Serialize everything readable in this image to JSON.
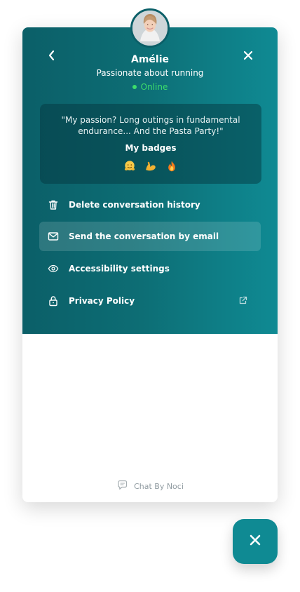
{
  "profile": {
    "name": "Amélie",
    "tagline": "Passionate about running",
    "status": "Online"
  },
  "quote_card": {
    "quote": "\"My passion? Long outings in fundamental endurance... And the Pasta Party!\"",
    "badges_title": "My badges",
    "badges": [
      "hugging-face-icon",
      "flexed-biceps-icon",
      "fire-icon"
    ]
  },
  "menu": {
    "delete_history_label": "Delete conversation history",
    "send_email_label": "Send the conversation by email",
    "accessibility_label": "Accessibility settings",
    "privacy_label": "Privacy Policy"
  },
  "footer": {
    "brand_text": "Chat By Noci"
  },
  "colors": {
    "teal_dark": "#0b5f68",
    "teal": "#0f8a93",
    "online_green": "#3ddc6b",
    "footer_gray": "#8f9aa0"
  },
  "icons": {
    "back": "chevron-left-icon",
    "close": "close-icon",
    "delete": "trash-icon",
    "email": "mail-icon",
    "accessibility": "eye-icon",
    "privacy": "lock-icon",
    "external": "external-link-icon",
    "brand": "chat-bubble-icon",
    "fab": "close-icon"
  }
}
